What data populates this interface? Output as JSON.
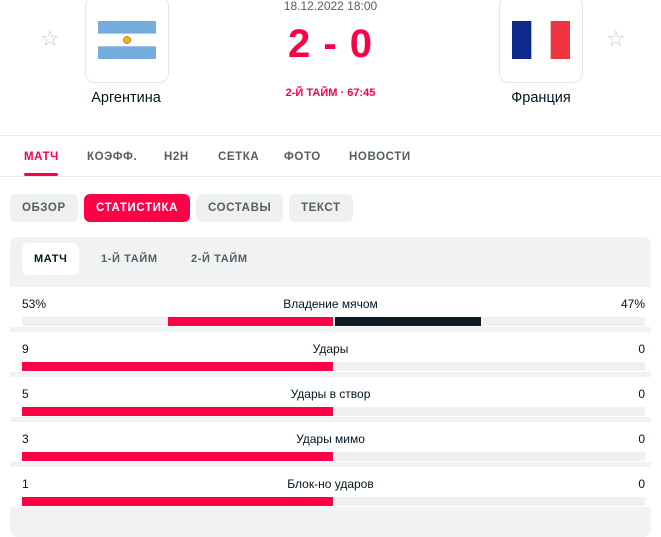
{
  "match": {
    "datetime": "18.12.2022 18:00",
    "score_home": "2",
    "score_sep": "-",
    "score_away": "0",
    "status": "2-Й ТАЙМ · 67:45"
  },
  "home": {
    "name": "Аргентина",
    "flag": "argentina-flag"
  },
  "away": {
    "name": "Франция",
    "flag": "france-flag"
  },
  "nav": {
    "items": [
      {
        "label": "МАТЧ",
        "active": true
      },
      {
        "label": "КОЭФФ.",
        "active": false
      },
      {
        "label": "H2H",
        "active": false
      },
      {
        "label": "СЕТКА",
        "active": false
      },
      {
        "label": "ФОТО",
        "active": false
      },
      {
        "label": "НОВОСТИ",
        "active": false
      }
    ]
  },
  "subtabs": [
    {
      "label": "ОБЗОР",
      "active": false
    },
    {
      "label": "СТАТИСТИКА",
      "active": true
    },
    {
      "label": "СОСТАВЫ",
      "active": false
    },
    {
      "label": "ТЕКСТ",
      "active": false
    }
  ],
  "periods": [
    {
      "label": "МАТЧ",
      "active": true
    },
    {
      "label": "1-Й ТАЙМ",
      "active": false
    },
    {
      "label": "2-Й ТАЙМ",
      "active": false
    }
  ],
  "stats": [
    {
      "name": "Владение мячом",
      "home": "53%",
      "away": "47%",
      "home_share": 0.53,
      "away_share": 0.47
    },
    {
      "name": "Удары",
      "home": "9",
      "away": "0",
      "home_share": 1.0,
      "away_share": 0.0
    },
    {
      "name": "Удары в створ",
      "home": "5",
      "away": "0",
      "home_share": 1.0,
      "away_share": 0.0
    },
    {
      "name": "Удары мимо",
      "home": "3",
      "away": "0",
      "home_share": 1.0,
      "away_share": 0.0
    },
    {
      "name": "Блок-но ударов",
      "home": "1",
      "away": "0",
      "home_share": 1.0,
      "away_share": 0.0
    }
  ],
  "colors": {
    "accent": "#ff0046",
    "away_bar": "#0d1b22",
    "track": "#eef0f1"
  }
}
